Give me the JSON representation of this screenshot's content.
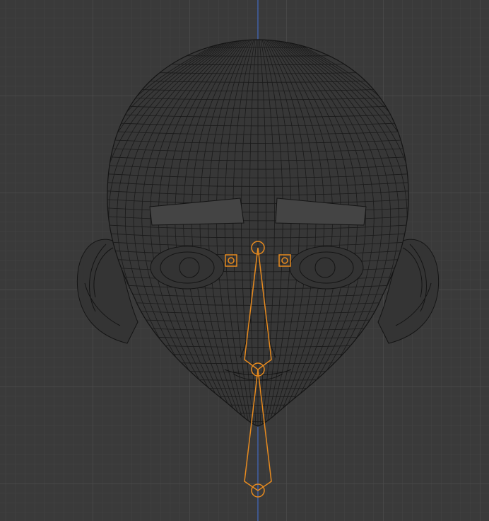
{
  "viewport": {
    "background": "#3a3a3a",
    "grid_minor_color": "#444444",
    "grid_major_color": "#4c4c4c",
    "axis_color": "#3f6fd8",
    "mesh_color": "#141414",
    "armature_color": "#e88b1f"
  },
  "scene": {
    "head_mesh": "wireframe-head",
    "armature": "face-rig",
    "eye_controls": [
      "square-control-left",
      "square-control-right"
    ]
  }
}
